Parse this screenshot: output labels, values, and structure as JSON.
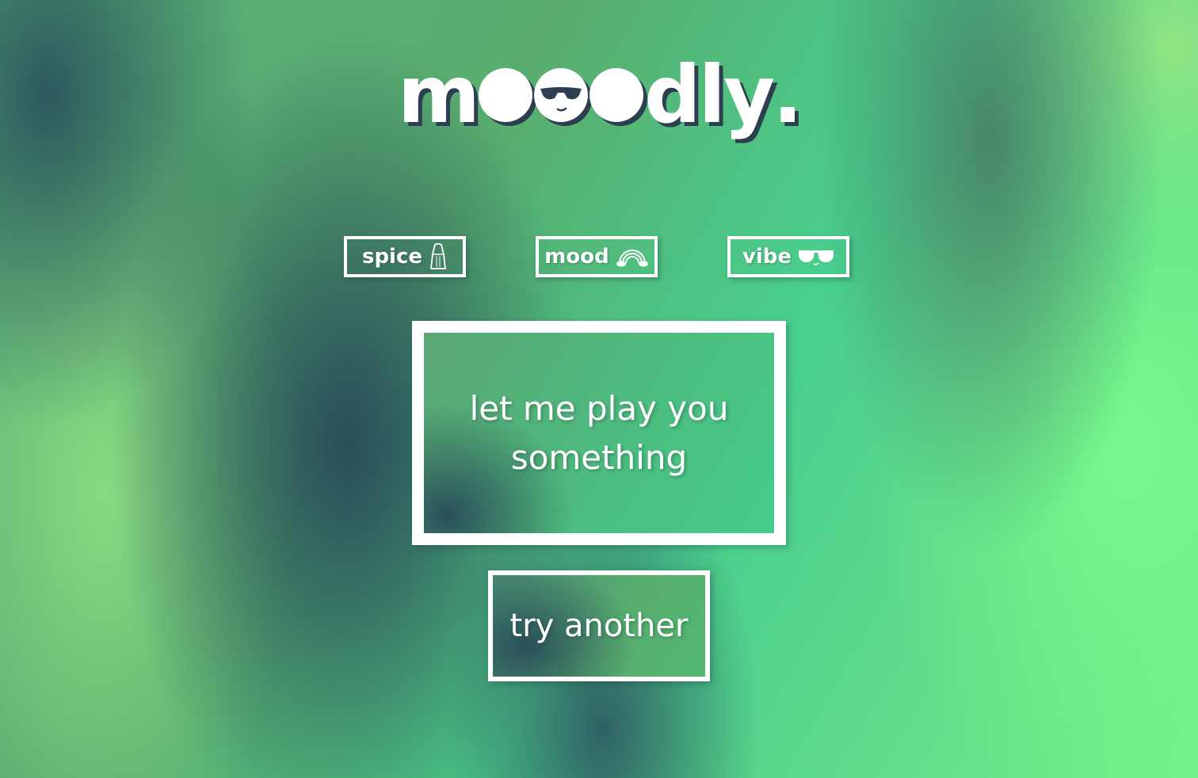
{
  "app": {
    "logo_prefix": "m",
    "logo_suffix": "dly",
    "logo_dot": ".",
    "logo_face_icon": "sunglasses-face-icon"
  },
  "options": [
    {
      "label": "spice",
      "icon": "salt-shaker-icon"
    },
    {
      "label": "mood",
      "icon": "rainbow-icon"
    },
    {
      "label": "vibe",
      "icon": "sunglasses-icon"
    }
  ],
  "card": {
    "text": "let me play you something"
  },
  "actions": {
    "try_label": "try another"
  },
  "colors": {
    "accent_dark": "#2c3e50",
    "foreground": "#ffffff",
    "bg_green": "#58ad6e",
    "bg_teal": "#48cf8e",
    "bg_lime": "#72f08a"
  }
}
